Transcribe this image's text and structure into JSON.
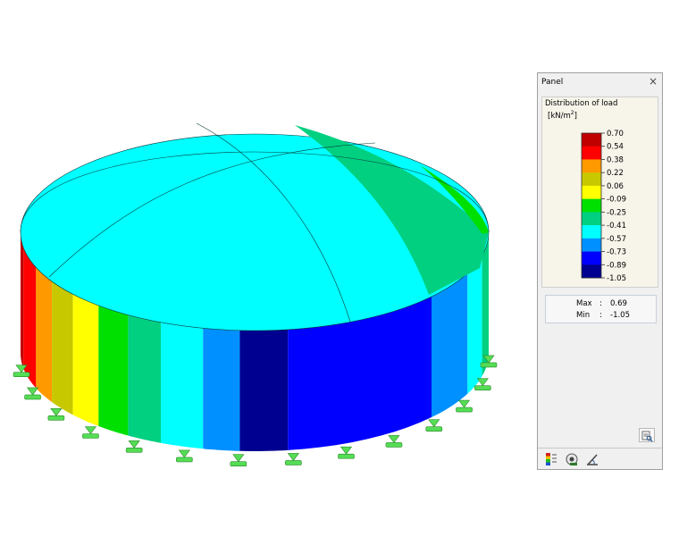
{
  "panel": {
    "title": "Panel",
    "close_glyph": "×",
    "legend": {
      "caption": "Distribution of load",
      "unit_prefix": "[kN/m",
      "unit_exponent": "2",
      "unit_suffix": "]",
      "values": [
        "0.70",
        "0.54",
        "0.38",
        "0.22",
        "0.06",
        "-0.09",
        "-0.25",
        "-0.41",
        "-0.57",
        "-0.73",
        "-0.89",
        "-1.05"
      ],
      "colors": [
        "#c00000",
        "#ff0000",
        "#ff9900",
        "#c8c800",
        "#ffff00",
        "#00e000",
        "#00d080",
        "#00ffff",
        "#0090ff",
        "#0000ff",
        "#000090"
      ]
    },
    "stats": {
      "max_label": "Max",
      "min_label": "Min",
      "separator": ":",
      "max_value": "0.69",
      "min_value": "-1.05"
    },
    "icons": {
      "settings": "table-settings-icon",
      "tab_1": "color-scale-icon",
      "tab_2": "view-display-icon",
      "tab_3": "measure-icon"
    }
  },
  "model": {
    "roof_color": "#00ffff",
    "roof_side_color": "#00d080",
    "wall_band_colors": [
      "#c00000",
      "#ff0000",
      "#ff9900",
      "#c8c800",
      "#ffff00",
      "#00e000",
      "#00d080",
      "#00ffff",
      "#0090ff",
      "#000090",
      "#0000ff",
      "#0090ff",
      "#00ffff",
      "#00d080"
    ],
    "support_color": "#55dd55"
  }
}
